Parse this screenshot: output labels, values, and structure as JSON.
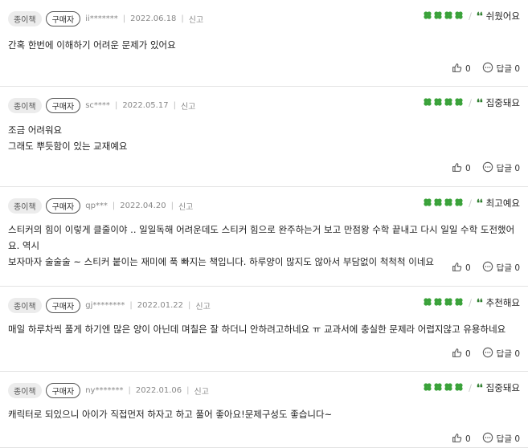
{
  "colors": {
    "clover": "#3aa23a",
    "quote": "#2a7b2a",
    "divider": "#e3e3e3"
  },
  "reviews": [
    {
      "format": "종이책",
      "buyer": "구매자",
      "user": "ii*******",
      "date": "2022.06.18",
      "report": "신고",
      "tag": "쉬웠어요",
      "rating": 4,
      "lines": [
        "간혹 한번에 이해하기 어려운 문제가 있어요"
      ],
      "likes": "0",
      "comments": "답글 0"
    },
    {
      "format": "종이책",
      "buyer": "구매자",
      "user": "sc****",
      "date": "2022.05.17",
      "report": "신고",
      "tag": "집중돼요",
      "rating": 4,
      "lines": [
        "조금 어려워요",
        "그래도 뿌듯함이 있는 교재예요"
      ],
      "likes": "0",
      "comments": "답글 0"
    },
    {
      "format": "종이책",
      "buyer": "구매자",
      "user": "qp***",
      "date": "2022.04.20",
      "report": "신고",
      "tag": "최고예요",
      "rating": 4,
      "lines": [
        "스티커의 힘이 이렇게 클줄이야 .. 일일독해 어려운데도 스티커 힘으로 완주하는거 보고 만점왕 수학 끝내고 다시 일일 수학 도전했어요. 역시",
        "보자마자 술술술 ~ 스티커 붙이는 재미에 푹 빠지는 책입니다. 하루양이 많지도 않아서 부담없이 척척척 이네요"
      ],
      "likes": "0",
      "comments": "답글 0"
    },
    {
      "format": "종이책",
      "buyer": "구매자",
      "user": "gj********",
      "date": "2022.01.22",
      "report": "신고",
      "tag": "추천해요",
      "rating": 4,
      "lines": [
        "매일 하루차씩 풀게 하기엔 많은 양이 아닌데 며칠은 잘 하더니 안하려고하네요 ㅠ 교과서에 충실한 문제라 어렵지않고 유용하네요"
      ],
      "likes": "0",
      "comments": "답글 0"
    },
    {
      "format": "종이책",
      "buyer": "구매자",
      "user": "ny*******",
      "date": "2022.01.06",
      "report": "신고",
      "tag": "집중돼요",
      "rating": 4,
      "lines": [
        "캐릭터로 되있으니 아이가 직접먼저 하자고 하고 풀어 좋아요!문제구성도 좋습니다~"
      ],
      "likes": "0",
      "comments": "답글 0"
    }
  ]
}
